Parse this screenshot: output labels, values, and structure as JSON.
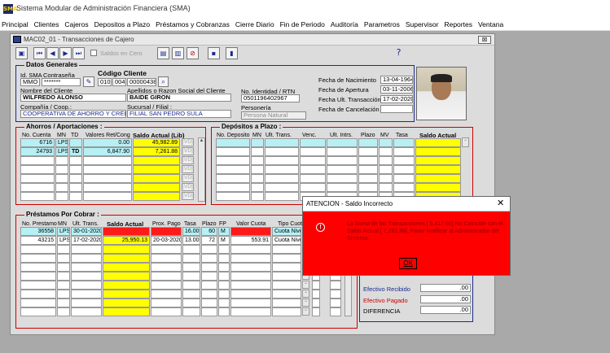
{
  "app": {
    "title": "Sistema Modular de Administración Financiera (SMA)",
    "logo": "SMA"
  },
  "menu": [
    "Principal",
    "Clientes",
    "Cajeros",
    "Depositos a Plazo",
    "Préstamos y Cobranzas",
    "Cierre Diario",
    "Fin de Periodo",
    "Auditoría",
    "Parametros",
    "Supervisor",
    "Reportes",
    "Ventana"
  ],
  "form": {
    "title": "MAC02_01 - Transacciones de Cajero",
    "close": "⊠"
  },
  "toolbar": {
    "saldos_label": "Saldos en Cero",
    "help": "?"
  },
  "datos": {
    "group_title": "Datos Generales",
    "id_sma_label": "Id. SMA",
    "id_sma": "MMO",
    "contrasena_label": "Contraseña",
    "contrasena": "*******",
    "codigo_label": "Código Cliente",
    "codigo_1": "010",
    "codigo_2": "004",
    "codigo_3": "000004381",
    "nombre_label": "Nombre del Cliente",
    "nombre": "WILFREDO ALONSO",
    "apellidos_label": "Apellidos o Razon Social del Cliente",
    "apellidos": "BAIDE GIRON",
    "compania_label": "Compañía / Coop.:",
    "compania": "COOPERATIVA DE AHORRO Y CRÉDITO",
    "sucursal_label": "Sucursal / Filial :",
    "sucursal": "FILIAL SAN PEDRO SULA",
    "identidad_label": "No. Identidad / RTN",
    "identidad": "0501196402967",
    "personeria_label": "Personería",
    "personeria": "Persona Natural",
    "f_nac_label": "Fecha de Nacimiento",
    "f_nac": "13-04-1964",
    "f_ap_label": "Fecha de Apertura",
    "f_ap": "03-11-2006",
    "f_ult_label": "Fecha Ult. Transacción",
    "f_ult": "17-02-2020",
    "f_canc_label": "Fecha de Cancelación",
    "f_canc": ""
  },
  "ahorros": {
    "title": "Ahorros / Aportaciones :",
    "headers": [
      "No. Cuenta",
      "MN",
      "TD",
      "Valores Ret/Cong",
      "Saldo Actual (Lib)"
    ],
    "rows": [
      {
        "cuenta": "6716",
        "mn": "LPS",
        "td": "",
        "ret": "0.00",
        "saldo": "45,982.89",
        "vd": "[VD]"
      },
      {
        "cuenta": "24793",
        "mn": "LPS",
        "td": "TD",
        "ret": "6,847.90",
        "saldo": "7,261.88",
        "vd": "[VD]"
      }
    ],
    "vd": "[VD]"
  },
  "depositos": {
    "title": "Depósitos a Plazo :",
    "headers": [
      "No. Deposito",
      "MN",
      "Ult. Trans.",
      "Venc.",
      "Ult. Intrs.",
      "Plazo",
      "MV",
      "Tasa",
      "Saldo Actual"
    ]
  },
  "prestamos": {
    "title": "Préstamos Por Cobrar :",
    "headers": [
      "No. Prestamo",
      "MN",
      "Ult. Trans.",
      "Saldo Actual",
      "Prox. Pago",
      "Tasa",
      "Plazo",
      "FP",
      "Valor Cuota",
      "Tipo Cuota"
    ],
    "rows": [
      {
        "num": "36558",
        "mn": "LPS",
        "ult": "30-01-2020",
        "saldo": "",
        "prox": "",
        "tasa": "16.00",
        "plazo": "60",
        "fp": "M",
        "cuota": "",
        "tipo": "Cuota Nive"
      },
      {
        "num": "43215",
        "mn": "LPS",
        "ult": "17-02-2020",
        "saldo": "25,950.13",
        "prox": "20-03-2020",
        "tasa": "13.00",
        "plazo": "72",
        "fp": "M",
        "cuota": "553.91",
        "tipo": "Cuota Nive"
      }
    ]
  },
  "totales": {
    "recibido_label": "Efectivo Recibido",
    "recibido": ".00",
    "pagado_label": "Efectivo Pagado",
    "pagado": ".00",
    "diferencia_label": "DIFERENCIA",
    "diferencia": ".00"
  },
  "dialog": {
    "title": "ATENCION - Saldo Incorrecto",
    "close": "✕",
    "icon": "!",
    "message": "La Suma de las Transacciones [       5,417.60] No Coincide con el Saldo Actual [       7,261.88], Favor Notificar al Administrador del Sistema.",
    "ok": "OK"
  },
  "colors": {
    "accent_red": "#ff0000",
    "highlight_yellow": "#ffff00",
    "cyan": "#b6f0f5"
  }
}
